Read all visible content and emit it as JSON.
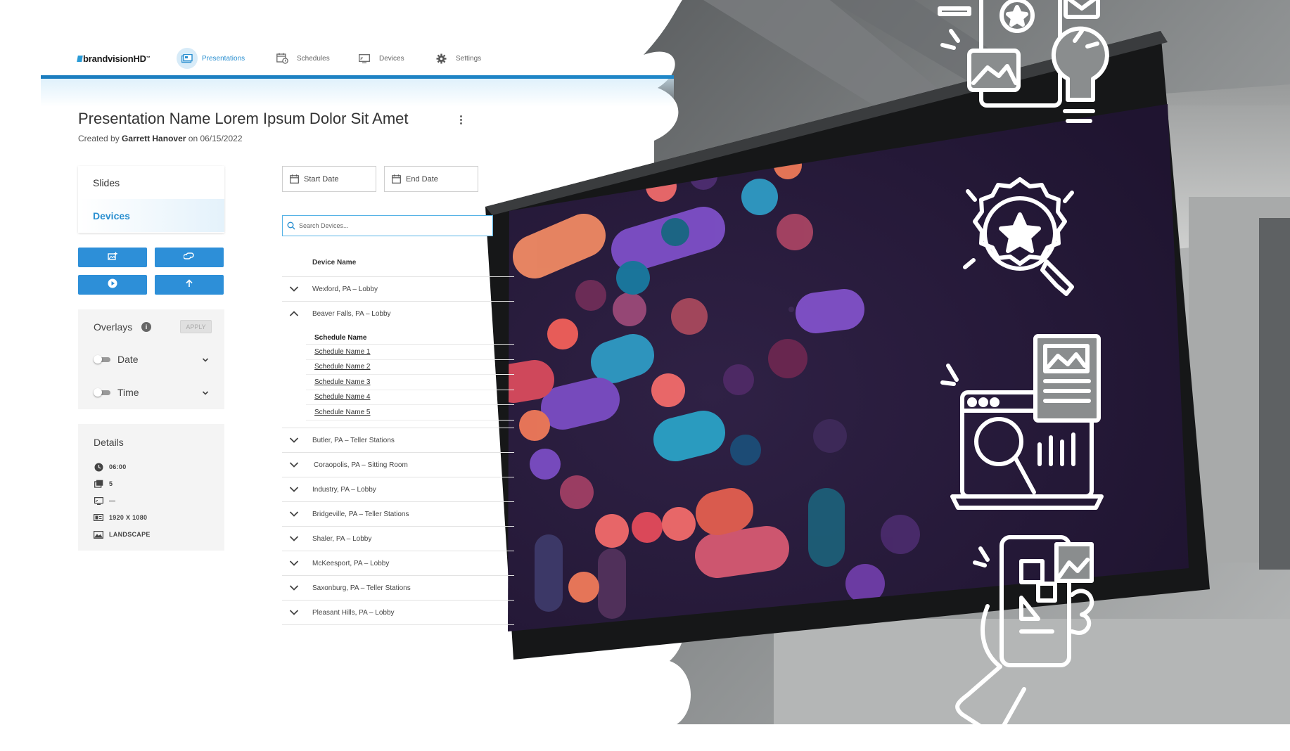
{
  "nav": {
    "logo_prefix": "brandvision",
    "logo_suffix": "HD",
    "logo_tm": "™",
    "items": [
      {
        "label": "Presentations",
        "icon": "presentations-icon",
        "active": true
      },
      {
        "label": "Schedules",
        "icon": "schedules-icon",
        "active": false
      },
      {
        "label": "Devices",
        "icon": "devices-icon",
        "active": false
      },
      {
        "label": "Settings",
        "icon": "gear-icon",
        "active": false
      }
    ]
  },
  "presentation": {
    "title": "Presentation Name Lorem Ipsum Dolor Sit Amet",
    "created_prefix": "Created by",
    "author": "Garrett Hanover",
    "created_on": "on 06/15/2022"
  },
  "tabs": {
    "slides": "Slides",
    "devices": "Devices"
  },
  "actions": [
    {
      "icon": "add-image-icon"
    },
    {
      "icon": "cast-icon"
    },
    {
      "icon": "play-icon"
    },
    {
      "icon": "upload-icon"
    }
  ],
  "overlays": {
    "heading": "Overlays",
    "info": "i",
    "apply": "APPLY",
    "items": [
      {
        "label": "Date",
        "enabled": false
      },
      {
        "label": "Time",
        "enabled": false
      }
    ]
  },
  "details": {
    "heading": "Details",
    "rows": [
      {
        "icon": "clock-icon",
        "value": "06:00"
      },
      {
        "icon": "slides-icon",
        "value": "5"
      },
      {
        "icon": "display-icon",
        "value": "—"
      },
      {
        "icon": "resolution-icon",
        "value": "1920 X 1080"
      },
      {
        "icon": "landscape-icon",
        "value": "LANDSCAPE"
      }
    ]
  },
  "filters": {
    "start_date": "Start Date",
    "end_date": "End Date",
    "search_placeholder": "Search Devices..."
  },
  "device_list": {
    "header": "Device Name",
    "rows": [
      {
        "name": "Wexford, PA – Lobby",
        "expanded": false
      },
      {
        "name": "Beaver Falls, PA – Lobby",
        "expanded": true
      },
      {
        "name": "Butler, PA – Teller Stations",
        "expanded": false
      },
      {
        "name": "Coraopolis, PA – Sitting Room",
        "expanded": false
      },
      {
        "name": "Industry, PA – Lobby",
        "expanded": false
      },
      {
        "name": "Bridgeville, PA – Teller Stations",
        "expanded": false
      },
      {
        "name": "Shaler, PA – Lobby",
        "expanded": false
      },
      {
        "name": "McKeesport, PA – Lobby",
        "expanded": false
      },
      {
        "name": "Saxonburg, PA – Teller Stations",
        "expanded": false
      },
      {
        "name": "Pleasant Hills, PA – Lobby",
        "expanded": false
      }
    ],
    "schedule_header": "Schedule Name",
    "schedules": [
      "Schedule Name 1",
      "Schedule Name 2",
      "Schedule Name 3",
      "Schedule Name 4",
      "Schedule Name 5"
    ]
  },
  "colors": {
    "accent": "#2d8fd8",
    "screen_bg": "#2a1b3d"
  }
}
